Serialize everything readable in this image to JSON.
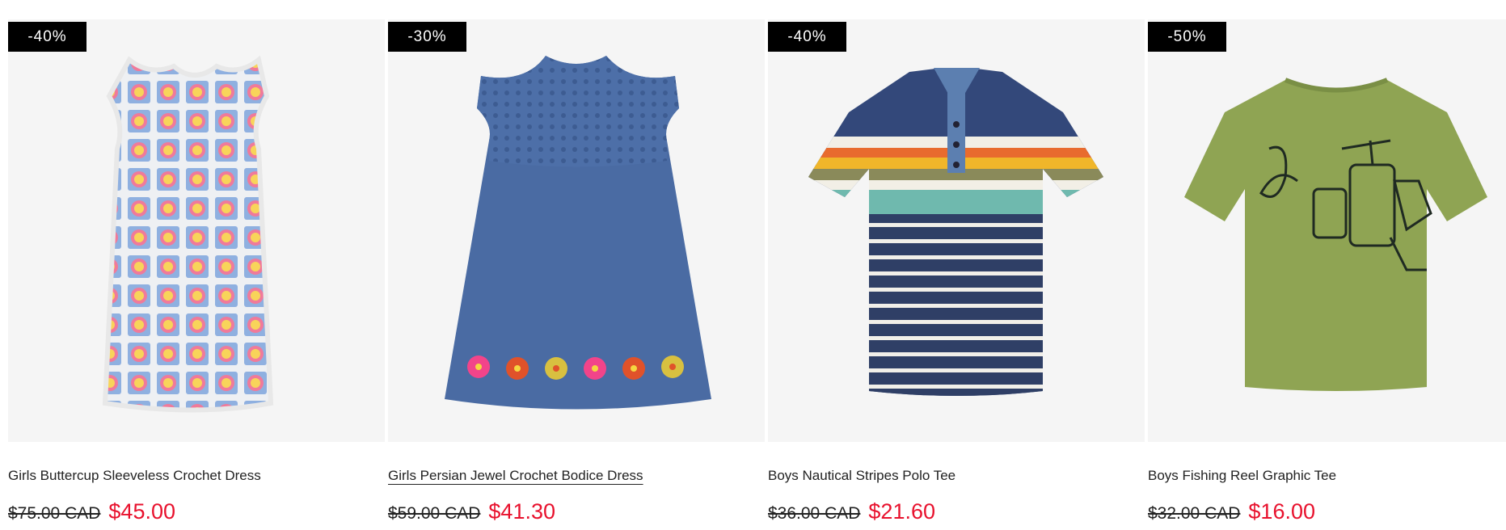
{
  "products": [
    {
      "badge": "-40%",
      "name": "Girls Buttercup Sleeveless Crochet Dress",
      "old_price": "$75.00 CAD",
      "new_price": "$45.00"
    },
    {
      "badge": "-30%",
      "name": "Girls Persian Jewel Crochet Bodice Dress",
      "old_price": "$59.00 CAD",
      "new_price": "$41.30"
    },
    {
      "badge": "-40%",
      "name": "Boys Nautical Stripes Polo Tee",
      "old_price": "$36.00 CAD",
      "new_price": "$21.60"
    },
    {
      "badge": "-50%",
      "name": "Boys Fishing Reel Graphic Tee",
      "old_price": "$32.00 CAD",
      "new_price": "$16.00"
    }
  ],
  "colors": {
    "sale_price": "#e8112d",
    "badge_bg": "#000000",
    "image_bg": "#f5f5f5"
  }
}
